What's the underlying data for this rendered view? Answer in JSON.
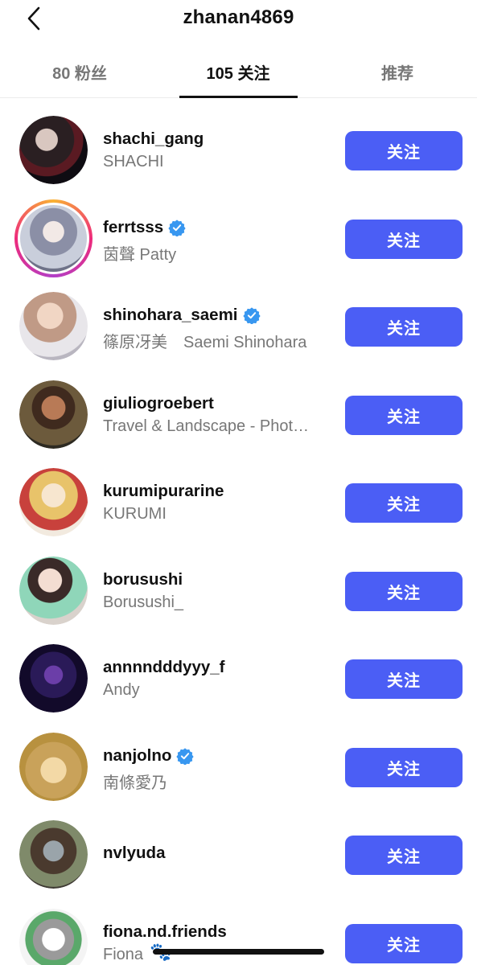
{
  "header": {
    "title": "zhanan4869",
    "back_icon": "chevron-left-icon"
  },
  "tabs": [
    {
      "label": "80 粉丝",
      "active": false
    },
    {
      "label": "105 关注",
      "active": true
    },
    {
      "label": "推荐",
      "active": false
    }
  ],
  "rows": [
    {
      "username": "shachi_gang",
      "fullname": "SHACHI",
      "verified": false,
      "story_ring": false,
      "button": "关注"
    },
    {
      "username": "ferrtsss",
      "fullname": "茵聲 Patty",
      "verified": true,
      "story_ring": true,
      "button": "关注"
    },
    {
      "username": "shinohara_saemi",
      "fullname": "篠原冴美　Saemi Shinohara",
      "verified": true,
      "story_ring": false,
      "button": "关注"
    },
    {
      "username": "giuliogroebert",
      "fullname": "Travel & Landscape - Phot…",
      "verified": false,
      "story_ring": false,
      "button": "关注"
    },
    {
      "username": "kurumipurarine",
      "fullname": "KURUMI",
      "verified": false,
      "story_ring": false,
      "button": "关注"
    },
    {
      "username": "borusushi",
      "fullname": "Borusushi_",
      "verified": false,
      "story_ring": false,
      "button": "关注"
    },
    {
      "username": "annnndddyyy_f",
      "fullname": "Andy",
      "verified": false,
      "story_ring": false,
      "button": "关注"
    },
    {
      "username": "nanjolno",
      "fullname": "南條愛乃",
      "verified": true,
      "story_ring": false,
      "button": "关注"
    },
    {
      "username": "nvlyuda",
      "fullname": "",
      "verified": false,
      "story_ring": false,
      "button": "关注"
    },
    {
      "username": "fiona.nd.friends",
      "fullname": "Fiona",
      "verified": false,
      "story_ring": false,
      "button": "关注"
    }
  ],
  "colors": {
    "accent": "#4b5ef5",
    "verified": "#3897f0"
  }
}
